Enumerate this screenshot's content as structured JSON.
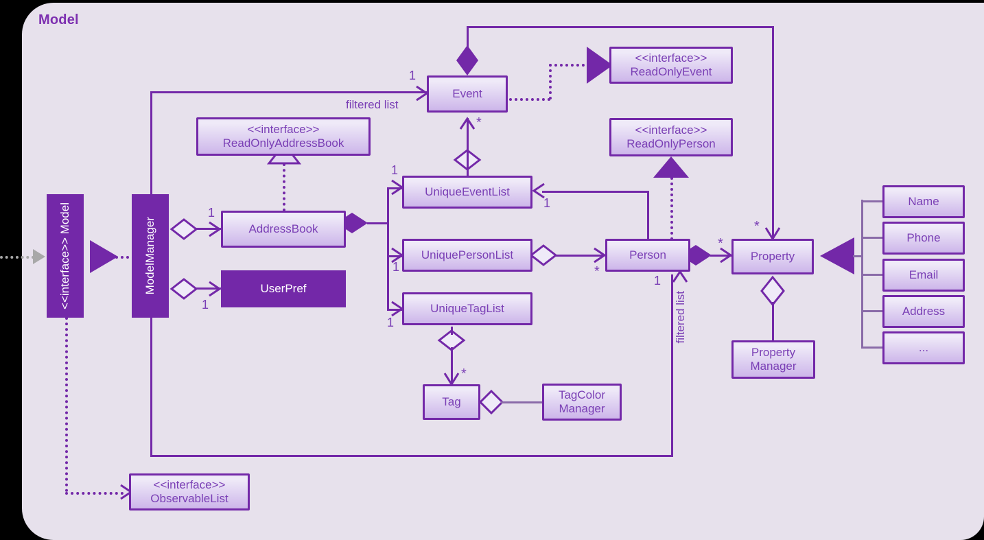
{
  "diagram": {
    "title": "Model",
    "type": "uml-class-diagram",
    "colors": {
      "panel_bg": "#e7e1ec",
      "outer_bg": "#000000",
      "stroke": "#7328a8",
      "title": "#7d2fb0",
      "box_text": "#7a3fb5",
      "solid_fill": "#7328a8",
      "solid_text": "#ffffff",
      "thin_line": "#8a6ba8",
      "gray_arrow": "#a8a8a8"
    },
    "classes": [
      {
        "id": "model",
        "name": "Model",
        "stereotype": "<<interface>>",
        "style": "solid-filled",
        "orientation": "vertical"
      },
      {
        "id": "modelmanager",
        "name": "ModelManager",
        "stereotype": "",
        "style": "solid-filled",
        "orientation": "vertical"
      },
      {
        "id": "readonlyaddressbook",
        "name": "ReadOnlyAddressBook",
        "stereotype": "<<interface>>",
        "style": "gradient"
      },
      {
        "id": "addressbook",
        "name": "AddressBook",
        "stereotype": "",
        "style": "gradient"
      },
      {
        "id": "userpref",
        "name": "UserPref",
        "stereotype": "",
        "style": "solid-filled"
      },
      {
        "id": "event",
        "name": "Event",
        "stereotype": "",
        "style": "gradient"
      },
      {
        "id": "readonlyevent",
        "name": "ReadOnlyEvent",
        "stereotype": "<<interface>>",
        "style": "gradient"
      },
      {
        "id": "readonlyperson",
        "name": "ReadOnlyPerson",
        "stereotype": "<<interface>>",
        "style": "gradient"
      },
      {
        "id": "uniqueeventlist",
        "name": "UniqueEventList",
        "stereotype": "",
        "style": "gradient"
      },
      {
        "id": "uniquepersonlist",
        "name": "UniquePersonList",
        "stereotype": "",
        "style": "gradient"
      },
      {
        "id": "uniquetaglist",
        "name": "UniqueTagList",
        "stereotype": "",
        "style": "gradient"
      },
      {
        "id": "person",
        "name": "Person",
        "stereotype": "",
        "style": "gradient"
      },
      {
        "id": "property",
        "name": "Property",
        "stereotype": "",
        "style": "gradient"
      },
      {
        "id": "propertymanager",
        "name": "Property Manager",
        "name_line1": "Property",
        "name_line2": "Manager",
        "stereotype": "",
        "style": "gradient"
      },
      {
        "id": "tag",
        "name": "Tag",
        "stereotype": "",
        "style": "gradient"
      },
      {
        "id": "tagcolormanager",
        "name": "TagColor Manager",
        "name_line1": "TagColor",
        "name_line2": "Manager",
        "stereotype": "",
        "style": "gradient"
      },
      {
        "id": "observablelist",
        "name": "ObservableList",
        "stereotype": "<<interface>>",
        "style": "gradient"
      },
      {
        "id": "attr_name",
        "name": "Name",
        "stereotype": "",
        "style": "gradient"
      },
      {
        "id": "attr_phone",
        "name": "Phone",
        "stereotype": "",
        "style": "gradient"
      },
      {
        "id": "attr_email",
        "name": "Email",
        "stereotype": "",
        "style": "gradient"
      },
      {
        "id": "attr_address",
        "name": "Address",
        "stereotype": "",
        "style": "gradient"
      },
      {
        "id": "attr_ellipsis",
        "name": "...",
        "stereotype": "",
        "style": "gradient"
      }
    ],
    "edge_labels": {
      "filtered_list_event": "filtered list",
      "filtered_list_person": "filtered list",
      "one_event": "1",
      "one_addressbook": "1",
      "one_userpref": "1",
      "one_uniqueeventlist": "1",
      "one_uniquepersonlist": "1",
      "one_uniquetaglist": "1",
      "one_person_to_uel": "1",
      "one_person_filtered": "1",
      "star_event": "*",
      "star_person": "*",
      "star_property_in": "*",
      "star_person_property": "*",
      "star_tag": "*"
    }
  }
}
